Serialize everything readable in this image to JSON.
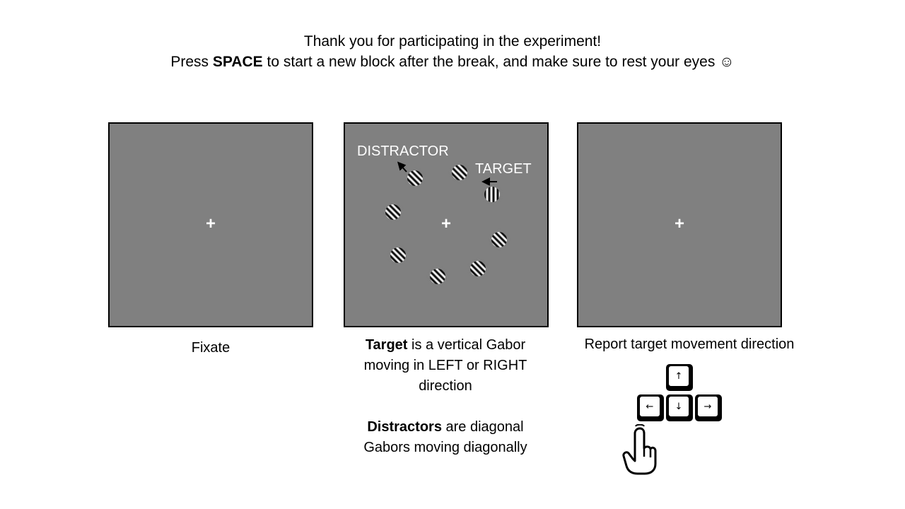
{
  "header": {
    "line1": "Thank you for participating in the experiment!",
    "line2_pre": "Press ",
    "line2_key": "SPACE",
    "line2_post": " to start a new block after the break, and make sure to rest your eyes ☺"
  },
  "panels": {
    "fixate": {
      "cross": "+",
      "caption": "Fixate"
    },
    "target": {
      "cross": "+",
      "distractor_label": "DISTRACTOR",
      "target_label": "TARGET",
      "caption_target_bold": "Target",
      "caption_target_rest1": " is a vertical Gabor",
      "caption_target_rest2": "moving in LEFT or RIGHT",
      "caption_target_rest3": "direction",
      "caption_distractor_bold": "Distractors",
      "caption_distractor_rest1": " are diagonal",
      "caption_distractor_rest2": "Gabors moving diagonally"
    },
    "report": {
      "cross": "+",
      "caption": "Report target movement direction"
    }
  },
  "keys": {
    "up": "↑",
    "left": "←",
    "down": "↓",
    "right": "→"
  },
  "icons": {
    "hand": "pointing-hand-icon",
    "gabor_distractor": "diagonal-gabor-patch",
    "gabor_target": "vertical-gabor-patch"
  },
  "colors": {
    "panel_background": "#808080",
    "panel_border": "#000000",
    "overlay_text": "#ffffff"
  }
}
